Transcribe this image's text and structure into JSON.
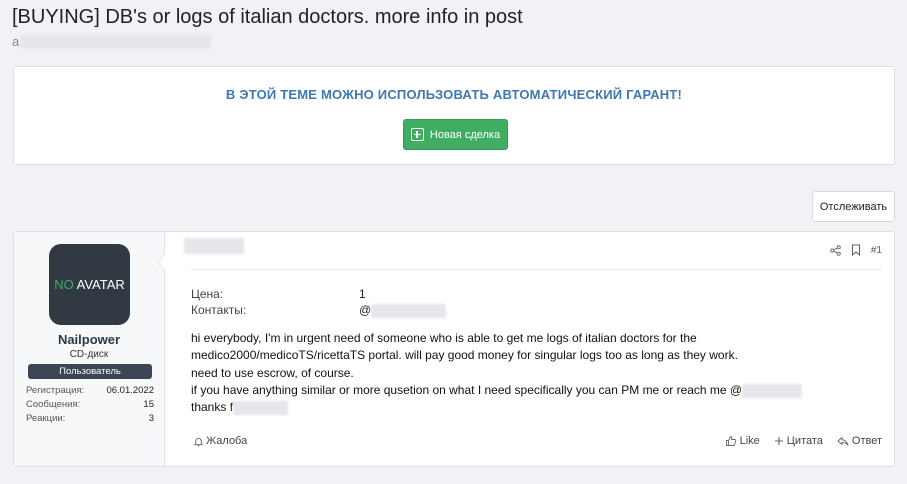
{
  "thread": {
    "title": "[BUYING] DB's or logs of italian doctors. more info in post",
    "author_initial": "a"
  },
  "guarantee": {
    "text": "В ЭТОЙ ТЕМЕ МОЖНО ИСПОЛЬЗОВАТЬ АВТОМАТИЧЕСКИЙ ГАРАНТ!",
    "button_label": "Новая сделка"
  },
  "watch_label": "Отслеживать",
  "post": {
    "number": "#1",
    "user": {
      "avatar_no": "NO",
      "avatar_text": " AVATAR",
      "name": "Nailpower",
      "title": "CD-диск",
      "banner": "Пользователь",
      "stats": [
        {
          "label": "Регистрация:",
          "value": "06.01.2022"
        },
        {
          "label": "Сообщения:",
          "value": "15"
        },
        {
          "label": "Реакции:",
          "value": "3"
        }
      ]
    },
    "fields": {
      "price_label": "Цена:",
      "price_value": "1",
      "contacts_label": "Контакты:",
      "contacts_value": "@"
    },
    "body": [
      "hi everybody, I'm in urgent need of someone who is able to get me logs of italian doctors for the",
      "medico2000/medicoTS/ricettaTS portal. will pay good money for singular logs too as long as they work.",
      "need to use escrow, of course.",
      "if you have anything similar or more qusetion on what I need specifically you can PM me or reach me @",
      "thanks f"
    ],
    "footer": {
      "report": "Жалоба",
      "like": "Like",
      "quote": "Цитата",
      "reply": "Ответ"
    }
  }
}
